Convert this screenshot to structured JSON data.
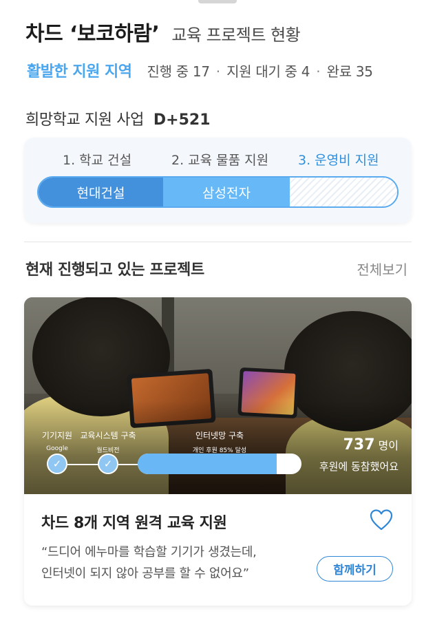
{
  "header": {
    "title": "차드 ‘보코하람’",
    "subtitle": "교육 프로젝트 현황"
  },
  "stats": {
    "label": "활발한 지원 지역",
    "in_progress": "진행 중 17",
    "waiting": "지원 대기 중 4",
    "completed": "완료 35",
    "separator": "·"
  },
  "project": {
    "name": "희망학교 지원 사업",
    "dday": "D+521",
    "steps": [
      "1. 학교 건설",
      "2. 교육 물품 지원",
      "3. 운영비 지원"
    ],
    "active_step": 3,
    "segments": [
      "현대건설",
      "삼성전자"
    ]
  },
  "current": {
    "heading": "현재 진행되고 있는 프로젝트",
    "see_all": "전체보기"
  },
  "card": {
    "milestones": [
      {
        "title": "기기지원",
        "sub": "Google",
        "done": true
      },
      {
        "title": "교육시스템 구축",
        "sub": "월드비전",
        "done": true
      },
      {
        "title": "인터넷망 구축",
        "sub": "개인 후원 85% 달성",
        "done": false
      }
    ],
    "progress_fraction": 0.85,
    "donor_count": "737",
    "donor_unit": "명이",
    "donor_text": "후원에 동참했어요",
    "title": "차드 8개 지역 원격 교육 지원",
    "quote_line1": "“드디어 에누마를 학습할 기기가 생겼는데,",
    "quote_line2": "인터넷이 되지 않아 공부를 할 수 없어요”",
    "join_label": "함께하기",
    "check_icon": "check-icon",
    "heart_icon": "heart-icon"
  },
  "colors": {
    "accent": "#4aa7ee",
    "segment_dark": "#4390dc",
    "segment_light": "#66b8f6",
    "button": "#2f86d6"
  }
}
